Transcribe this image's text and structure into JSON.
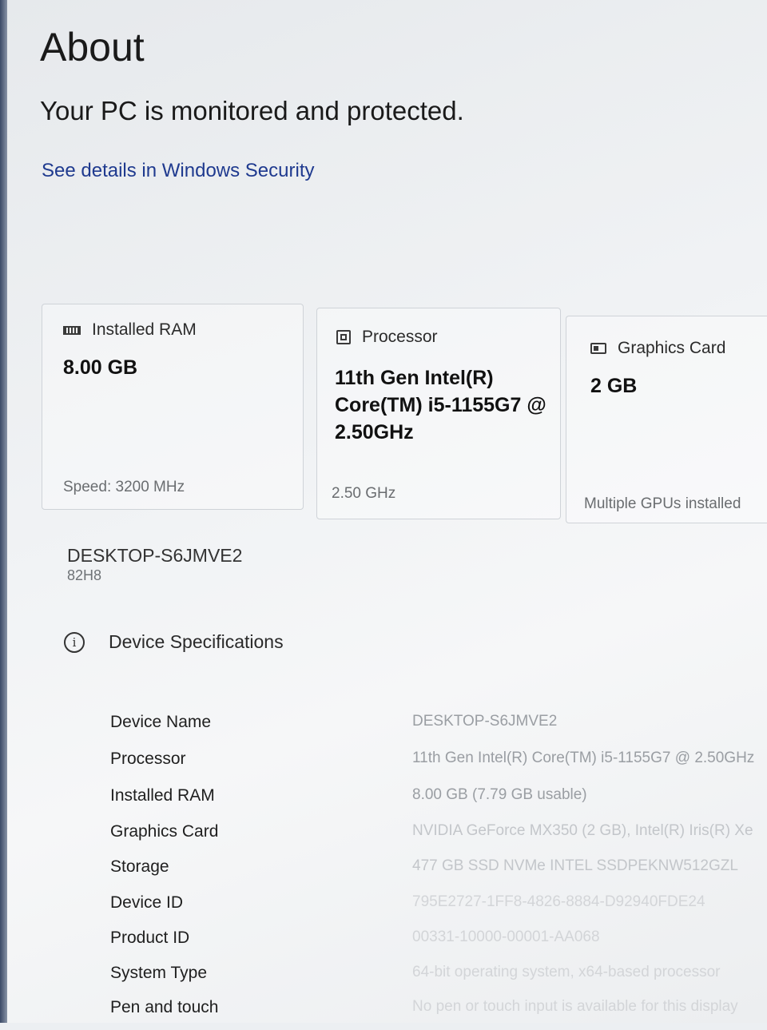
{
  "page": {
    "title": "About",
    "protection_status": "Your PC is monitored and protected.",
    "security_link": "See details in Windows Security"
  },
  "cards": {
    "ram": {
      "icon": "memory-icon",
      "label": "Installed RAM",
      "value": "8.00 GB",
      "footer": "Speed: 3200 MHz"
    },
    "processor": {
      "icon": "processor-icon",
      "label": "Processor",
      "value": "11th Gen Intel(R) Core(TM) i5-1155G7 @ 2.50GHz",
      "footer": "2.50 GHz"
    },
    "graphics": {
      "icon": "graphics-card-icon",
      "label": "Graphics Card",
      "value": "2 GB",
      "footer": "Multiple GPUs installed"
    }
  },
  "device": {
    "name": "DESKTOP-S6JMVE2",
    "model": "82H8"
  },
  "specifications": {
    "header": "Device Specifications",
    "rows": [
      {
        "label": "Device Name",
        "value": "DESKTOP-S6JMVE2"
      },
      {
        "label": "Processor",
        "value": "11th Gen Intel(R) Core(TM) i5-1155G7 @ 2.50GHz"
      },
      {
        "label": "Installed RAM",
        "value": "8.00 GB (7.79 GB usable)"
      },
      {
        "label": "Graphics Card",
        "value": "NVIDIA GeForce MX350 (2 GB), Intel(R) Iris(R) Xe"
      },
      {
        "label": "Storage",
        "value": "477 GB SSD NVMe INTEL SSDPEKNW512GZL"
      },
      {
        "label": "Device ID",
        "value": "795E2727-1FF8-4826-8884-D92940FDE24"
      },
      {
        "label": "Product ID",
        "value": "00331-10000-00001-AA068"
      },
      {
        "label": "System Type",
        "value": "64-bit operating system, x64-based processor"
      },
      {
        "label": "Pen and touch",
        "value": "No pen or touch input is available for this display"
      }
    ]
  }
}
